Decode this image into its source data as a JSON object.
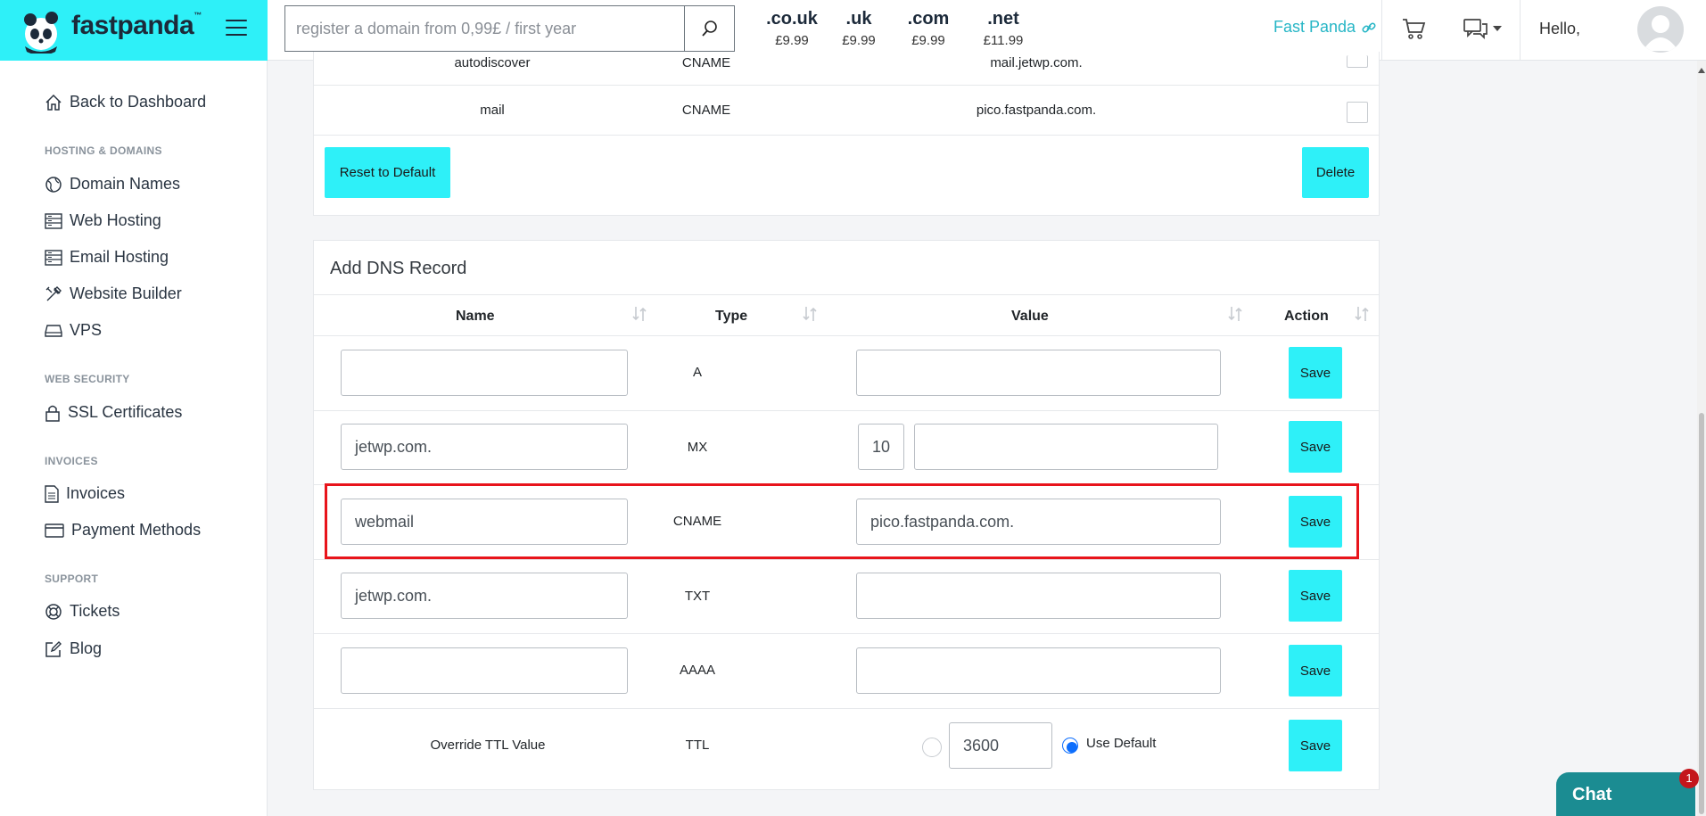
{
  "header": {
    "brand": "fastpanda",
    "brand_tm": "™",
    "search_placeholder": "register a domain from 0,99£ / first year",
    "tlds": [
      {
        "ext": ".co.uk",
        "price": "£9.99"
      },
      {
        "ext": ".uk",
        "price": "£9.99"
      },
      {
        "ext": ".com",
        "price": "£9.99"
      },
      {
        "ext": ".net",
        "price": "£11.99"
      }
    ],
    "fast_panda_link": "Fast Panda",
    "greeting": "Hello,"
  },
  "sidebar": {
    "back": "Back to Dashboard",
    "sections": {
      "hosting": "HOSTING & DOMAINS",
      "security": "WEB SECURITY",
      "invoices": "INVOICES",
      "support": "SUPPORT"
    },
    "items": {
      "domain_names": "Domain Names",
      "web_hosting": "Web Hosting",
      "email_hosting": "Email Hosting",
      "website_builder": "Website Builder",
      "vps": "VPS",
      "ssl": "SSL Certificates",
      "invoices": "Invoices",
      "payment_methods": "Payment Methods",
      "tickets": "Tickets",
      "blog": "Blog"
    }
  },
  "records_table": {
    "partial_row": {
      "name": "autodiscover",
      "type": "CNAME",
      "value": "mail.jetwp.com."
    },
    "row": {
      "name": "mail",
      "type": "CNAME",
      "value": "pico.fastpanda.com."
    },
    "reset_label": "Reset to Default",
    "delete_label": "Delete"
  },
  "add_dns": {
    "title": "Add DNS Record",
    "columns": {
      "name": "Name",
      "type": "Type",
      "value": "Value",
      "action": "Action"
    },
    "save_label": "Save",
    "rows": [
      {
        "type": "A",
        "name": "",
        "value": ""
      },
      {
        "type": "MX",
        "name": "jetwp.com.",
        "priority": "10",
        "value": ""
      },
      {
        "type": "CNAME",
        "name": "webmail",
        "value": "pico.fastpanda.com."
      },
      {
        "type": "TXT",
        "name": "jetwp.com.",
        "value": ""
      },
      {
        "type": "AAAA",
        "name": "",
        "value": ""
      }
    ],
    "ttl": {
      "label": "Override TTL Value",
      "type": "TTL",
      "value": "3600",
      "default_label": "Use Default"
    }
  },
  "chat": {
    "label": "Chat",
    "badge": "1"
  },
  "colors": {
    "brand": "#2ef0f8",
    "highlight": "#e8141b",
    "chat": "#1b8c92"
  }
}
